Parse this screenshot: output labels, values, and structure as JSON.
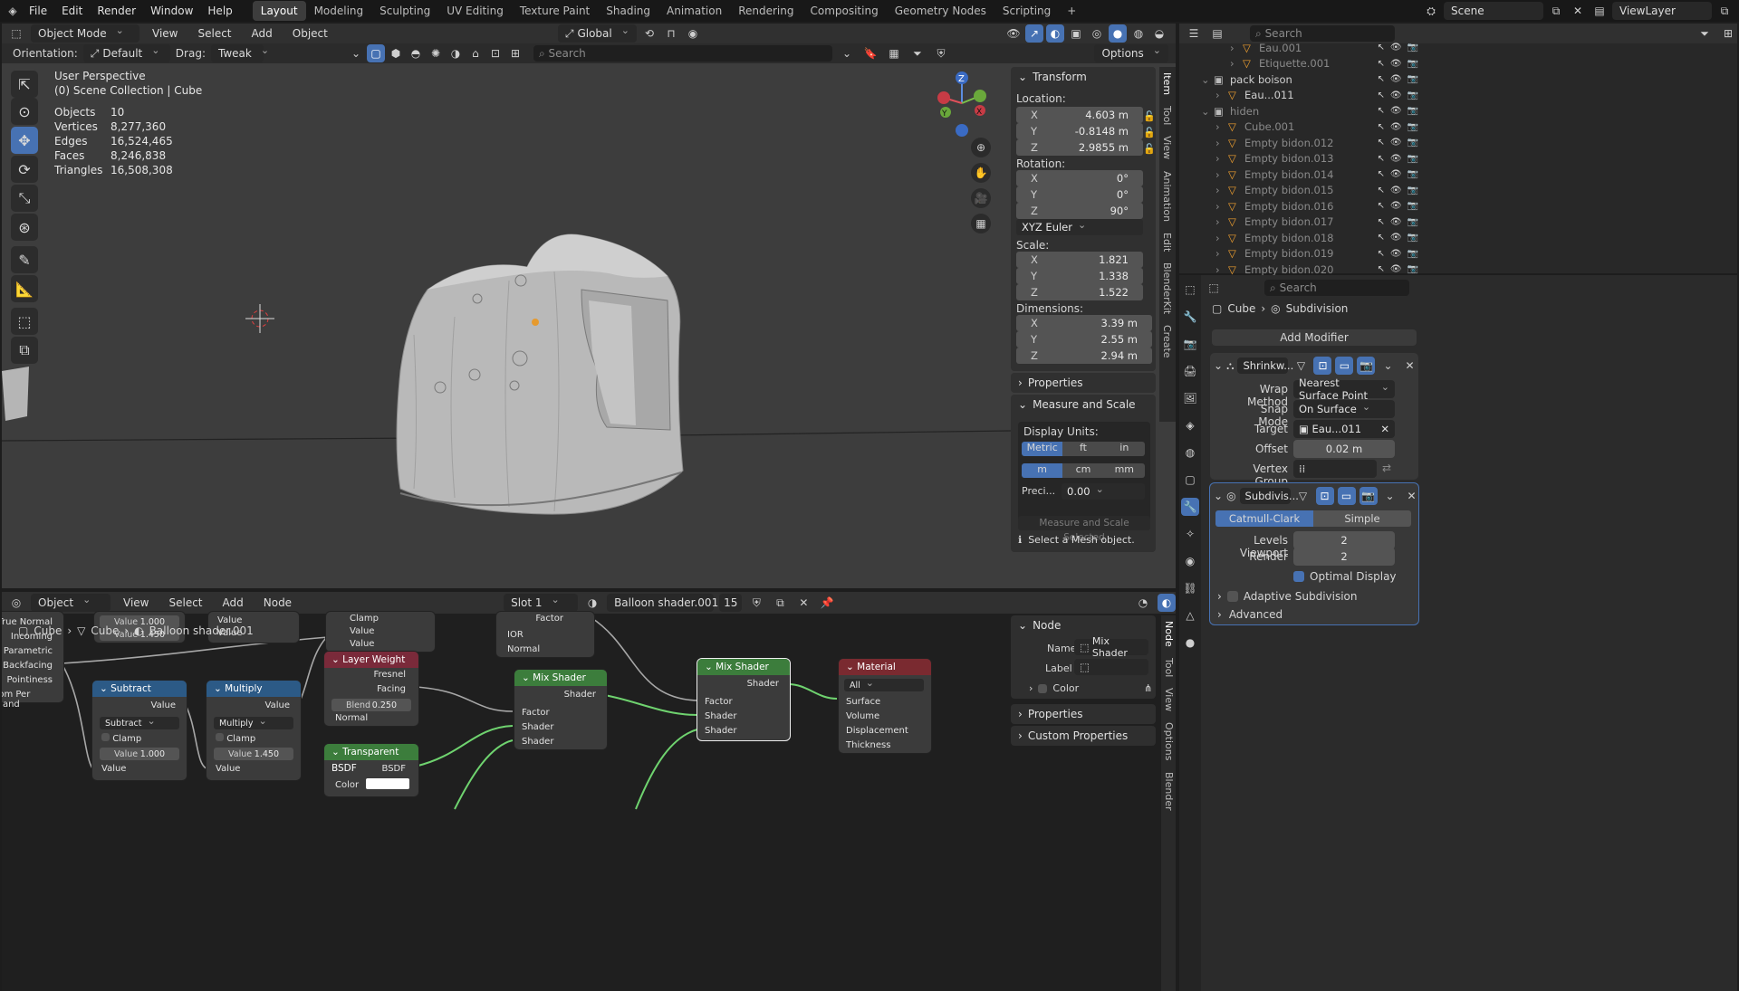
{
  "topbar": {
    "menus": [
      "File",
      "Edit",
      "Render",
      "Window",
      "Help"
    ],
    "workspaces": [
      "Layout",
      "Modeling",
      "Sculpting",
      "UV Editing",
      "Texture Paint",
      "Shading",
      "Animation",
      "Rendering",
      "Compositing",
      "Geometry Nodes",
      "Scripting"
    ],
    "active_workspace": "Layout",
    "plus": "+",
    "scene": "Scene",
    "viewlayer": "ViewLayer"
  },
  "viewport_header": {
    "mode": "Object Mode",
    "menus": [
      "View",
      "Select",
      "Add",
      "Object"
    ],
    "transform_orientation": "Global",
    "search_placeholder": "Search"
  },
  "tool_settings": {
    "orientation_label": "Orientation:",
    "orientation_value": "Default",
    "drag_label": "Drag:",
    "drag_value": "Tweak",
    "options": "Options"
  },
  "overlay_info": {
    "perspective": "User Perspective",
    "collection": "(0) Scene Collection | Cube",
    "stats": [
      {
        "k": "Objects",
        "v": "10"
      },
      {
        "k": "Vertices",
        "v": "8,277,360"
      },
      {
        "k": "Edges",
        "v": "16,524,465"
      },
      {
        "k": "Faces",
        "v": "8,246,838"
      },
      {
        "k": "Triangles",
        "v": "16,508,308"
      }
    ]
  },
  "gizmo": {
    "z": "Z",
    "y": "Y",
    "x": "X"
  },
  "npanel": {
    "transform_title": "Transform",
    "location_label": "Location:",
    "location": [
      {
        "a": "X",
        "v": "4.603 m"
      },
      {
        "a": "Y",
        "v": "-0.8148 m"
      },
      {
        "a": "Z",
        "v": "2.9855 m"
      }
    ],
    "rotation_label": "Rotation:",
    "rotation": [
      {
        "a": "X",
        "v": "0°"
      },
      {
        "a": "Y",
        "v": "0°"
      },
      {
        "a": "Z",
        "v": "90°"
      }
    ],
    "rotation_mode": "XYZ Euler",
    "scale_label": "Scale:",
    "scale": [
      {
        "a": "X",
        "v": "1.821"
      },
      {
        "a": "Y",
        "v": "1.338"
      },
      {
        "a": "Z",
        "v": "1.522"
      }
    ],
    "dimensions_label": "Dimensions:",
    "dimensions": [
      {
        "a": "X",
        "v": "3.39 m"
      },
      {
        "a": "Y",
        "v": "2.55 m"
      },
      {
        "a": "Z",
        "v": "2.94 m"
      }
    ],
    "properties": "Properties",
    "measure_title": "Measure and Scale",
    "display_units": "Display Units:",
    "units1": [
      "Metric",
      "ft",
      "in"
    ],
    "units2": [
      "m",
      "cm",
      "mm"
    ],
    "precision_label": "Preci...",
    "precision_value": "0.00",
    "measure_button": "Measure and Scale Selected",
    "select_msg": "Select a Mesh object.",
    "tabs": [
      "Item",
      "Tool",
      "View",
      "Animation",
      "Edit",
      "BlenderKit",
      "Create"
    ]
  },
  "outliner": {
    "search_placeholder": "Search",
    "rows": [
      {
        "name": "Eau.001",
        "indent": 3
      },
      {
        "name": "Etiquette.001",
        "indent": 3
      },
      {
        "name": "pack boison",
        "indent": 1
      },
      {
        "name": "Eau...011",
        "indent": 2
      },
      {
        "name": "hiden",
        "indent": 1
      },
      {
        "name": "Cube.001",
        "indent": 2
      },
      {
        "name": "Empty bidon.012",
        "indent": 2
      },
      {
        "name": "Empty bidon.013",
        "indent": 2
      },
      {
        "name": "Empty bidon.014",
        "indent": 2
      },
      {
        "name": "Empty bidon.015",
        "indent": 2
      },
      {
        "name": "Empty bidon.016",
        "indent": 2
      },
      {
        "name": "Empty bidon.017",
        "indent": 2
      },
      {
        "name": "Empty bidon.018",
        "indent": 2
      },
      {
        "name": "Empty bidon.019",
        "indent": 2
      },
      {
        "name": "Empty bidon.020",
        "indent": 2
      }
    ]
  },
  "properties": {
    "search_placeholder": "Search",
    "breadcrumb_obj": "Cube",
    "breadcrumb_mod": "Subdivision",
    "add_modifier": "Add Modifier",
    "shrink_name": "Shrinkw...",
    "wrap_method_label": "Wrap Method",
    "wrap_method": "Nearest Surface Point",
    "snap_mode_label": "Snap Mode",
    "snap_mode": "On Surface",
    "target_label": "Target",
    "target": "Eau...011",
    "offset_label": "Offset",
    "offset": "0.02 m",
    "vgroup_label": "Vertex Group",
    "subdiv_name": "Subdivis...",
    "catmull": "Catmull-Clark",
    "simple": "Simple",
    "levels_label": "Levels Viewport",
    "levels": "2",
    "render_label": "Render",
    "render": "2",
    "optimal": "Optimal Display",
    "adaptive": "Adaptive Subdivision",
    "advanced": "Advanced"
  },
  "node_header": {
    "type": "Object",
    "menus": [
      "View",
      "Select",
      "Add",
      "Node"
    ],
    "slot": "Slot 1",
    "material": "Balloon shader.001",
    "users": "15",
    "breadcrumb": [
      "Cube",
      "Cube",
      "Balloon shader.001"
    ]
  },
  "nodes": {
    "geometry_rows": [
      "True Normal",
      "Incoming",
      "Parametric",
      "Backfacing",
      "Pointiness",
      "dom Per Island"
    ],
    "val_top1": "Value",
    "val_top1_v": "1.000",
    "val_top2": "Value",
    "val_top2_v": "1.450",
    "value_a": "Value",
    "value_b": "Value",
    "clamp_top": "Clamp",
    "value_c": "Value",
    "value_d": "Value",
    "ior": "IOR",
    "normal_top": "Normal",
    "factor_top": "Factor",
    "layer_weight": "Layer Weight",
    "fresnel": "Fresnel",
    "facing": "Facing",
    "blend": "Blend",
    "blend_v": "0.250",
    "normal": "Normal",
    "subtract_title": "Subtract",
    "subtract_value": "Value",
    "subtract_op": "Subtract",
    "clamp": "Clamp",
    "sub_val": "Value",
    "sub_val_v": "1.000",
    "sub_in": "Value",
    "multiply_title": "Multiply",
    "multiply_value": "Value",
    "multiply_op": "Multiply",
    "mul_clamp": "Clamp",
    "mul_val": "Value",
    "mul_val_v": "1.450",
    "mul_in": "Value",
    "transparent": "Transparent BSDF",
    "bsdf": "BSDF",
    "color": "Color",
    "mix1_title": "Mix Shader",
    "mix1_shader_out": "Shader",
    "mix1_factor": "Factor",
    "mix1_shader1": "Shader",
    "mix1_shader2": "Shader",
    "mix2_title": "Mix Shader",
    "mix2_shader_out": "Shader",
    "mix2_factor": "Factor",
    "mix2_shader1": "Shader",
    "mix2_shader2": "Shader",
    "output_title": "Material Output",
    "output_target": "All",
    "surface": "Surface",
    "volume": "Volume",
    "displacement": "Displacement",
    "thickness": "Thickness"
  },
  "node_panel": {
    "title": "Node",
    "name_label": "Name",
    "name_value": "Mix Shader",
    "label_label": "Label",
    "color": "Color",
    "properties": "Properties",
    "custom": "Custom Properties",
    "tabs": [
      "Node",
      "Tool",
      "View",
      "Options",
      "Blender"
    ]
  },
  "colors": {
    "accent": "#4772b3",
    "viewport_bg": "#3d3d3d",
    "shader_green": "#3c7d3c",
    "math_blue": "#2c5a86",
    "output_red": "#7a2a30"
  }
}
